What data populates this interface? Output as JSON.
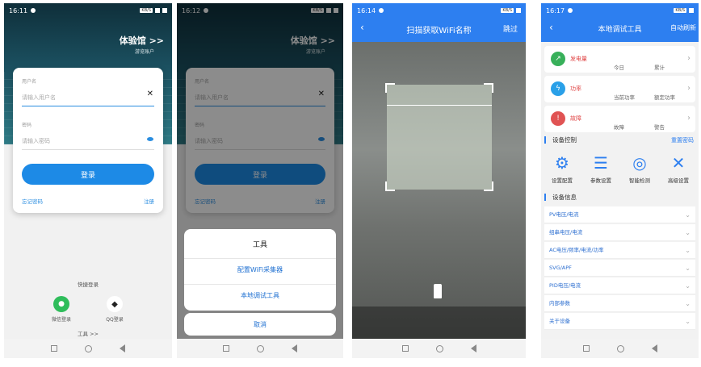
{
  "status": {
    "s1_time": "16:11",
    "s2_time": "16:12",
    "s3_time": "16:14",
    "s4_time": "16:17",
    "chip": "KB/S"
  },
  "login": {
    "experience_title": "体验馆 >>",
    "experience_sub": "游览账户",
    "username_label": "用户名",
    "username_placeholder": "请输入用户名",
    "password_label": "密码",
    "password_placeholder": "请输入密码",
    "login_button": "登录",
    "forgot": "忘记密码",
    "register": "注册",
    "quick_login": "快捷登录",
    "wechat_login": "微信登录",
    "qq_login": "QQ登录",
    "tools_link": "工具 >>"
  },
  "tool_sheet": {
    "title": "工具",
    "items": [
      "配置WiFi采集器",
      "本地调试工具"
    ],
    "cancel": "取消"
  },
  "scan": {
    "title": "扫描获取WiFi名称",
    "skip": "跳过"
  },
  "debug": {
    "title": "本地调试工具",
    "auto_refresh": "自动刷新",
    "metrics": [
      {
        "name": "发电量",
        "c1": "今日",
        "c2": "累计",
        "color": "#38b05a",
        "glyph": "↗"
      },
      {
        "name": "功率",
        "c1": "当前功率",
        "c2": "额定功率",
        "color": "#2aa0e8",
        "glyph": "ϟ"
      },
      {
        "name": "故障",
        "c1": "故障",
        "c2": "警告",
        "color": "#e05353",
        "glyph": "!"
      }
    ],
    "device_control": "设备控制",
    "reset_password": "重置密码",
    "controls": [
      "设置配置",
      "参数设置",
      "智能检测",
      "高级设置"
    ],
    "device_info": "设备信息",
    "info_items": [
      "PV电压/电流",
      "组串电压/电流",
      "AC电压/频率/电流/功率",
      "SVG/APF",
      "PID电压/电流",
      "内部参数",
      "关于设备"
    ]
  }
}
